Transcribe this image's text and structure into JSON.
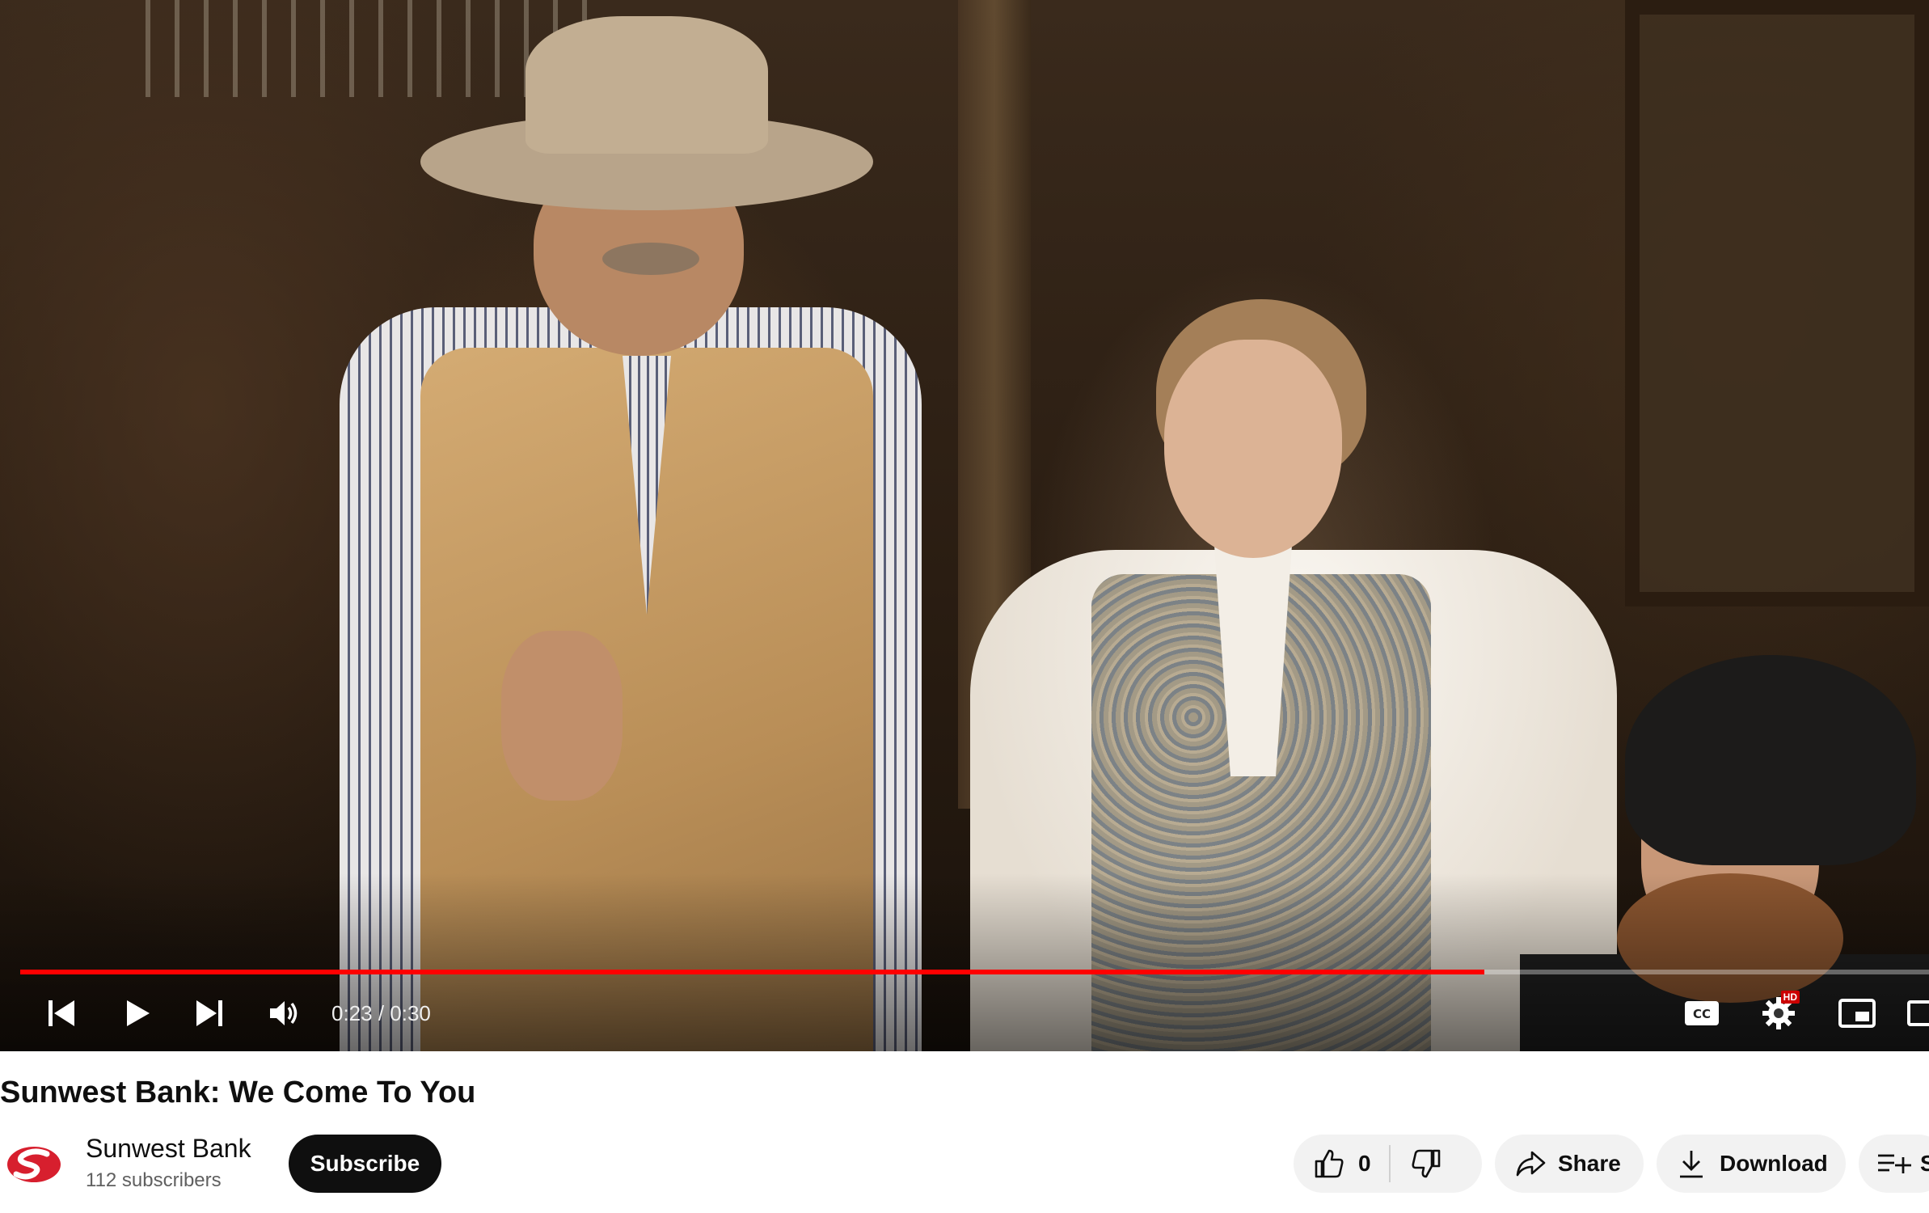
{
  "video": {
    "current_time": "0:23",
    "duration": "0:30",
    "progress_fraction": 0.767,
    "accent_color": "#ff0000",
    "hd_badge": "HD",
    "controls": {
      "previous_icon": "skip-previous-icon",
      "play_icon": "play-icon",
      "next_icon": "skip-next-icon",
      "volume_icon": "volume-icon",
      "captions_icon": "closed-captions-icon",
      "settings_icon": "gear-icon",
      "miniplayer_icon": "miniplayer-icon",
      "theater_icon": "theater-mode-icon"
    }
  },
  "title": "Sunwest Bank: We Come To You",
  "channel": {
    "name": "Sunwest Bank",
    "subscribers": "112 subscribers",
    "logo_color": "#d71f2e",
    "subscribe_label": "Subscribe"
  },
  "actions": {
    "like_count": "0",
    "share_label": "Share",
    "download_label": "Download",
    "save_label": "S",
    "icons": {
      "like": "thumbs-up-icon",
      "dislike": "thumbs-down-icon",
      "share": "share-arrow-icon",
      "download": "download-icon",
      "save": "add-to-playlist-icon"
    }
  }
}
